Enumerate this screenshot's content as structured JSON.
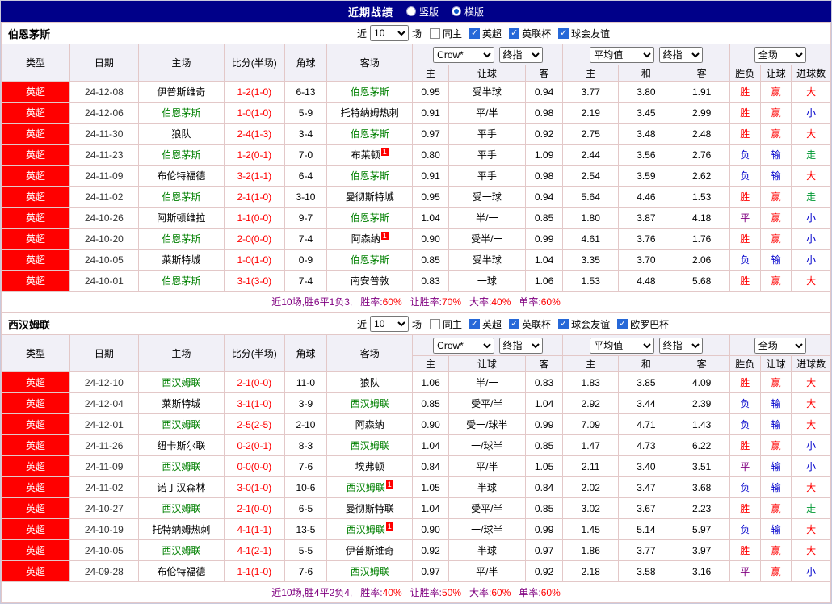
{
  "topbar": {
    "title": "近期战绩",
    "radios": [
      {
        "label": "竖版",
        "selected": false
      },
      {
        "label": "横版",
        "selected": true
      }
    ]
  },
  "controls": {
    "near_label": "近",
    "games_value": "10",
    "games_label": "场",
    "bookmaker": "Crow*",
    "final_label": "终指",
    "average_label": "平均值",
    "fulltime_label": "全场"
  },
  "columns": {
    "type": "类型",
    "date": "日期",
    "home": "主场",
    "score": "比分(半场)",
    "corner": "角球",
    "away": "客场",
    "odds_home": "主",
    "odds_handicap": "让球",
    "odds_away": "客",
    "avg_home": "主",
    "avg_draw": "和",
    "avg_away": "客",
    "result_wl": "胜负",
    "result_handicap": "让球",
    "result_goals": "进球数"
  },
  "result_colors": {
    "胜": "#ff0000",
    "负": "#0000cc",
    "平": "#800080",
    "赢": "#ff0000",
    "输": "#0000cc",
    "走": "#009933",
    "大": "#ff0000",
    "小": "#0000cc"
  },
  "colors": {
    "league_bg": "#ff0000",
    "featured_team": "#008000",
    "score": "#ff0000",
    "topbar_bg": "#000089",
    "header_bg": "#f1f0f7",
    "grid_border": "#e3c8c8",
    "summary_text": "#800080",
    "summary_value": "#ff0000"
  },
  "sections": [
    {
      "team": "伯恩茅斯",
      "filters": [
        {
          "label": "同主",
          "checked": false
        },
        {
          "label": "英超",
          "checked": true
        },
        {
          "label": "英联杯",
          "checked": true
        },
        {
          "label": "球会友谊",
          "checked": true
        }
      ],
      "rows": [
        {
          "league": "英超",
          "date": "24-12-08",
          "home": "伊普斯维奇",
          "home_featured": false,
          "home_card": "",
          "score": "1-2(1-0)",
          "corner": "6-13",
          "away": "伯恩茅斯",
          "away_featured": true,
          "away_card": "",
          "odds": [
            "0.95",
            "受半球",
            "0.94"
          ],
          "avg": [
            "3.77",
            "3.80",
            "1.91"
          ],
          "results": [
            "胜",
            "赢",
            "大"
          ]
        },
        {
          "league": "英超",
          "date": "24-12-06",
          "home": "伯恩茅斯",
          "home_featured": true,
          "home_card": "",
          "score": "1-0(1-0)",
          "corner": "5-9",
          "away": "托特纳姆热刺",
          "away_featured": false,
          "away_card": "",
          "odds": [
            "0.91",
            "平/半",
            "0.98"
          ],
          "avg": [
            "2.19",
            "3.45",
            "2.99"
          ],
          "results": [
            "胜",
            "赢",
            "小"
          ]
        },
        {
          "league": "英超",
          "date": "24-11-30",
          "home": "狼队",
          "home_featured": false,
          "home_card": "",
          "score": "2-4(1-3)",
          "corner": "3-4",
          "away": "伯恩茅斯",
          "away_featured": true,
          "away_card": "",
          "odds": [
            "0.97",
            "平手",
            "0.92"
          ],
          "avg": [
            "2.75",
            "3.48",
            "2.48"
          ],
          "results": [
            "胜",
            "赢",
            "大"
          ]
        },
        {
          "league": "英超",
          "date": "24-11-23",
          "home": "伯恩茅斯",
          "home_featured": true,
          "home_card": "",
          "score": "1-2(0-1)",
          "corner": "7-0",
          "away": "布莱顿",
          "away_featured": false,
          "away_card": "1",
          "odds": [
            "0.80",
            "平手",
            "1.09"
          ],
          "avg": [
            "2.44",
            "3.56",
            "2.76"
          ],
          "results": [
            "负",
            "输",
            "走"
          ]
        },
        {
          "league": "英超",
          "date": "24-11-09",
          "home": "布伦特福德",
          "home_featured": false,
          "home_card": "",
          "score": "3-2(1-1)",
          "corner": "6-4",
          "away": "伯恩茅斯",
          "away_featured": true,
          "away_card": "",
          "odds": [
            "0.91",
            "平手",
            "0.98"
          ],
          "avg": [
            "2.54",
            "3.59",
            "2.62"
          ],
          "results": [
            "负",
            "输",
            "大"
          ]
        },
        {
          "league": "英超",
          "date": "24-11-02",
          "home": "伯恩茅斯",
          "home_featured": true,
          "home_card": "",
          "score": "2-1(1-0)",
          "corner": "3-10",
          "away": "曼彻斯特城",
          "away_featured": false,
          "away_card": "",
          "odds": [
            "0.95",
            "受一球",
            "0.94"
          ],
          "avg": [
            "5.64",
            "4.46",
            "1.53"
          ],
          "results": [
            "胜",
            "赢",
            "走"
          ]
        },
        {
          "league": "英超",
          "date": "24-10-26",
          "home": "阿斯顿维拉",
          "home_featured": false,
          "home_card": "",
          "score": "1-1(0-0)",
          "corner": "9-7",
          "away": "伯恩茅斯",
          "away_featured": true,
          "away_card": "",
          "odds": [
            "1.04",
            "半/一",
            "0.85"
          ],
          "avg": [
            "1.80",
            "3.87",
            "4.18"
          ],
          "results": [
            "平",
            "赢",
            "小"
          ]
        },
        {
          "league": "英超",
          "date": "24-10-20",
          "home": "伯恩茅斯",
          "home_featured": true,
          "home_card": "",
          "score": "2-0(0-0)",
          "corner": "7-4",
          "away": "阿森纳",
          "away_featured": false,
          "away_card": "1",
          "odds": [
            "0.90",
            "受半/一",
            "0.99"
          ],
          "avg": [
            "4.61",
            "3.76",
            "1.76"
          ],
          "results": [
            "胜",
            "赢",
            "小"
          ]
        },
        {
          "league": "英超",
          "date": "24-10-05",
          "home": "莱斯特城",
          "home_featured": false,
          "home_card": "",
          "score": "1-0(1-0)",
          "corner": "0-9",
          "away": "伯恩茅斯",
          "away_featured": true,
          "away_card": "",
          "odds": [
            "0.85",
            "受半球",
            "1.04"
          ],
          "avg": [
            "3.35",
            "3.70",
            "2.06"
          ],
          "results": [
            "负",
            "输",
            "小"
          ]
        },
        {
          "league": "英超",
          "date": "24-10-01",
          "home": "伯恩茅斯",
          "home_featured": true,
          "home_card": "",
          "score": "3-1(3-0)",
          "corner": "7-4",
          "away": "南安普敦",
          "away_featured": false,
          "away_card": "",
          "odds": [
            "0.83",
            "一球",
            "1.06"
          ],
          "avg": [
            "1.53",
            "4.48",
            "5.68"
          ],
          "results": [
            "胜",
            "赢",
            "大"
          ]
        }
      ],
      "summary": {
        "prefix": "近10场,胜6平1负3,",
        "stats": [
          {
            "label": "胜率:",
            "value": "60%"
          },
          {
            "label": "让胜率:",
            "value": "70%"
          },
          {
            "label": "大率:",
            "value": "40%"
          },
          {
            "label": "单率:",
            "value": "60%"
          }
        ]
      }
    },
    {
      "team": "西汉姆联",
      "filters": [
        {
          "label": "同主",
          "checked": false
        },
        {
          "label": "英超",
          "checked": true
        },
        {
          "label": "英联杯",
          "checked": true
        },
        {
          "label": "球会友谊",
          "checked": true
        },
        {
          "label": "欧罗巴杯",
          "checked": true
        }
      ],
      "rows": [
        {
          "league": "英超",
          "date": "24-12-10",
          "home": "西汉姆联",
          "home_featured": true,
          "home_card": "",
          "score": "2-1(0-0)",
          "corner": "11-0",
          "away": "狼队",
          "away_featured": false,
          "away_card": "",
          "odds": [
            "1.06",
            "半/一",
            "0.83"
          ],
          "avg": [
            "1.83",
            "3.85",
            "4.09"
          ],
          "results": [
            "胜",
            "赢",
            "大"
          ]
        },
        {
          "league": "英超",
          "date": "24-12-04",
          "home": "莱斯特城",
          "home_featured": false,
          "home_card": "",
          "score": "3-1(1-0)",
          "corner": "3-9",
          "away": "西汉姆联",
          "away_featured": true,
          "away_card": "",
          "odds": [
            "0.85",
            "受平/半",
            "1.04"
          ],
          "avg": [
            "2.92",
            "3.44",
            "2.39"
          ],
          "results": [
            "负",
            "输",
            "大"
          ]
        },
        {
          "league": "英超",
          "date": "24-12-01",
          "home": "西汉姆联",
          "home_featured": true,
          "home_card": "",
          "score": "2-5(2-5)",
          "corner": "2-10",
          "away": "阿森纳",
          "away_featured": false,
          "away_card": "",
          "odds": [
            "0.90",
            "受一/球半",
            "0.99"
          ],
          "avg": [
            "7.09",
            "4.71",
            "1.43"
          ],
          "results": [
            "负",
            "输",
            "大"
          ]
        },
        {
          "league": "英超",
          "date": "24-11-26",
          "home": "纽卡斯尔联",
          "home_featured": false,
          "home_card": "",
          "score": "0-2(0-1)",
          "corner": "8-3",
          "away": "西汉姆联",
          "away_featured": true,
          "away_card": "",
          "odds": [
            "1.04",
            "一/球半",
            "0.85"
          ],
          "avg": [
            "1.47",
            "4.73",
            "6.22"
          ],
          "results": [
            "胜",
            "赢",
            "小"
          ]
        },
        {
          "league": "英超",
          "date": "24-11-09",
          "home": "西汉姆联",
          "home_featured": true,
          "home_card": "",
          "score": "0-0(0-0)",
          "corner": "7-6",
          "away": "埃弗顿",
          "away_featured": false,
          "away_card": "",
          "odds": [
            "0.84",
            "平/半",
            "1.05"
          ],
          "avg": [
            "2.11",
            "3.40",
            "3.51"
          ],
          "results": [
            "平",
            "输",
            "小"
          ]
        },
        {
          "league": "英超",
          "date": "24-11-02",
          "home": "诺丁汉森林",
          "home_featured": false,
          "home_card": "",
          "score": "3-0(1-0)",
          "corner": "10-6",
          "away": "西汉姆联",
          "away_featured": true,
          "away_card": "1",
          "odds": [
            "1.05",
            "半球",
            "0.84"
          ],
          "avg": [
            "2.02",
            "3.47",
            "3.68"
          ],
          "results": [
            "负",
            "输",
            "大"
          ]
        },
        {
          "league": "英超",
          "date": "24-10-27",
          "home": "西汉姆联",
          "home_featured": true,
          "home_card": "",
          "score": "2-1(0-0)",
          "corner": "6-5",
          "away": "曼彻斯特联",
          "away_featured": false,
          "away_card": "",
          "odds": [
            "1.04",
            "受平/半",
            "0.85"
          ],
          "avg": [
            "3.02",
            "3.67",
            "2.23"
          ],
          "results": [
            "胜",
            "赢",
            "走"
          ]
        },
        {
          "league": "英超",
          "date": "24-10-19",
          "home": "托特纳姆热刺",
          "home_featured": false,
          "home_card": "",
          "score": "4-1(1-1)",
          "corner": "13-5",
          "away": "西汉姆联",
          "away_featured": true,
          "away_card": "1",
          "odds": [
            "0.90",
            "一/球半",
            "0.99"
          ],
          "avg": [
            "1.45",
            "5.14",
            "5.97"
          ],
          "results": [
            "负",
            "输",
            "大"
          ]
        },
        {
          "league": "英超",
          "date": "24-10-05",
          "home": "西汉姆联",
          "home_featured": true,
          "home_card": "",
          "score": "4-1(2-1)",
          "corner": "5-5",
          "away": "伊普斯维奇",
          "away_featured": false,
          "away_card": "",
          "odds": [
            "0.92",
            "半球",
            "0.97"
          ],
          "avg": [
            "1.86",
            "3.77",
            "3.97"
          ],
          "results": [
            "胜",
            "赢",
            "大"
          ]
        },
        {
          "league": "英超",
          "date": "24-09-28",
          "home": "布伦特福德",
          "home_featured": false,
          "home_card": "",
          "score": "1-1(1-0)",
          "corner": "7-6",
          "away": "西汉姆联",
          "away_featured": true,
          "away_card": "",
          "odds": [
            "0.97",
            "平/半",
            "0.92"
          ],
          "avg": [
            "2.18",
            "3.58",
            "3.16"
          ],
          "results": [
            "平",
            "赢",
            "小"
          ]
        }
      ],
      "summary": {
        "prefix": "近10场,胜4平2负4,",
        "stats": [
          {
            "label": "胜率:",
            "value": "40%"
          },
          {
            "label": "让胜率:",
            "value": "50%"
          },
          {
            "label": "大率:",
            "value": "60%"
          },
          {
            "label": "单率:",
            "value": "60%"
          }
        ]
      }
    }
  ]
}
